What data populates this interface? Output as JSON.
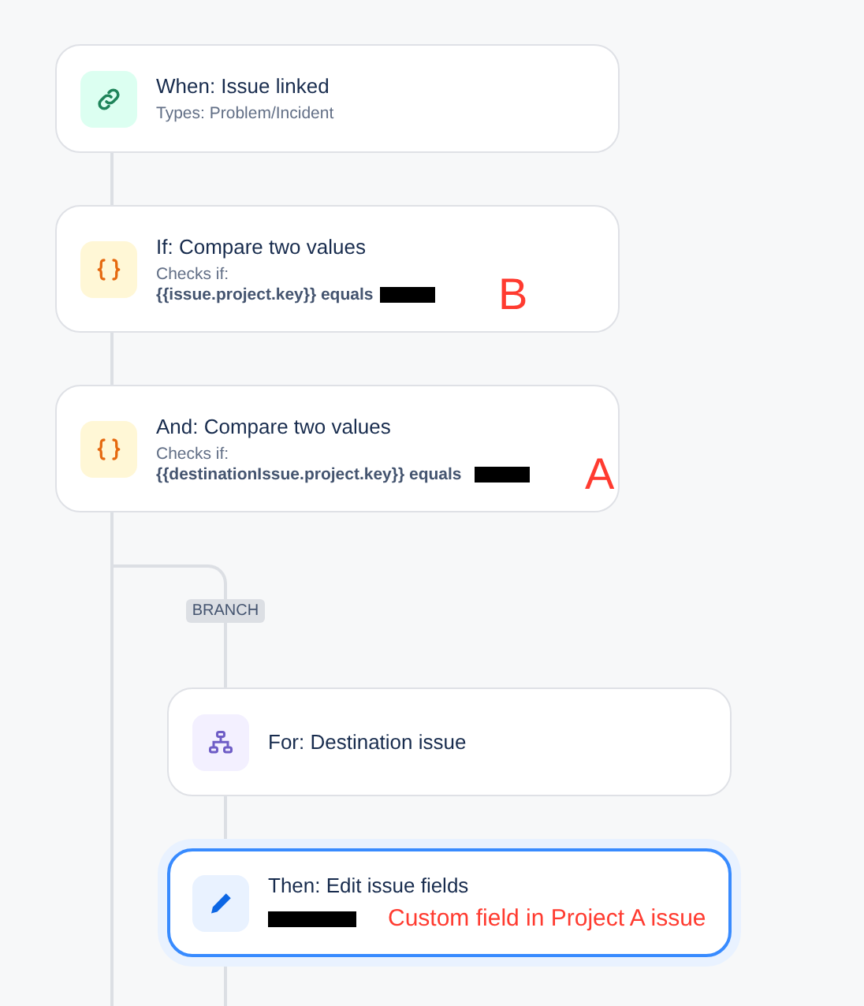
{
  "steps": [
    {
      "kind": "trigger",
      "title": "When: Issue linked",
      "subtitle": "Types: Problem/Incident",
      "selected": false
    },
    {
      "kind": "condition",
      "title": "If: Compare two values",
      "subtitle": "Checks if:",
      "detail": "{{issue.project.key}} equals",
      "redacted": true,
      "annotation": "B",
      "selected": false
    },
    {
      "kind": "condition",
      "title": "And: Compare two values",
      "subtitle": "Checks if:",
      "detail": "{{destinationIssue.project.key}} equals",
      "redacted": true,
      "annotation": "A",
      "selected": false
    }
  ],
  "branch": {
    "label": "BRANCH",
    "steps": [
      {
        "kind": "branch",
        "title": "For: Destination issue",
        "selected": false
      },
      {
        "kind": "action",
        "title": "Then: Edit issue fields",
        "redacted": true,
        "note": "Custom field in Project A issue",
        "selected": true
      }
    ]
  }
}
